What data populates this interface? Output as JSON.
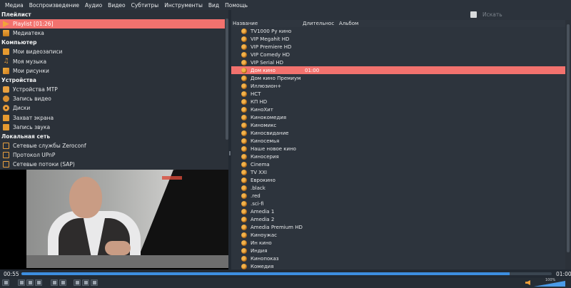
{
  "menu": [
    "Медиа",
    "Воспроизведение",
    "Аудио",
    "Видео",
    "Субтитры",
    "Инструменты",
    "Вид",
    "Помощь"
  ],
  "sidebar": {
    "sections": [
      {
        "title": "Плейлист",
        "items": [
          {
            "label": "Playlist [01:26]",
            "icon": "play-icon",
            "selected": true
          },
          {
            "label": "Медиатека",
            "icon": "library-icon",
            "selected": false
          }
        ]
      },
      {
        "title": "Компьютер",
        "items": [
          {
            "label": "Мои видеозаписи",
            "icon": "video-folder-icon",
            "selected": false
          },
          {
            "label": "Моя музыка",
            "icon": "music-note-icon",
            "selected": false
          },
          {
            "label": "Мои рисунки",
            "icon": "picture-icon",
            "selected": false
          }
        ]
      },
      {
        "title": "Устройства",
        "items": [
          {
            "label": "Устройства MTP",
            "icon": "device-icon",
            "selected": false
          },
          {
            "label": "Запись видео",
            "icon": "camera-icon",
            "selected": false
          },
          {
            "label": "Диски",
            "icon": "disc-icon",
            "selected": false
          },
          {
            "label": "Захват экрана",
            "icon": "screen-capture-icon",
            "selected": false
          },
          {
            "label": "Запись звука",
            "icon": "audio-capture-icon",
            "selected": false
          }
        ]
      },
      {
        "title": "Локальная сеть",
        "items": [
          {
            "label": "Сетевые службы Zeroconf",
            "icon": "network-icon",
            "selected": false
          },
          {
            "label": "Протокол UPnP",
            "icon": "network-icon",
            "selected": false
          },
          {
            "label": "Сетевые потоки (SAP)",
            "icon": "network-icon",
            "selected": false
          }
        ]
      }
    ]
  },
  "search": {
    "placeholder": "Искать"
  },
  "playlist": {
    "columns": {
      "name": "Название",
      "duration": "Длительнос",
      "album": "Альбом"
    },
    "rows": [
      {
        "name": "TV1000 Ру кино",
        "duration": "",
        "selected": false
      },
      {
        "name": "VIP Megahit HD",
        "duration": "",
        "selected": false
      },
      {
        "name": "VIP Premiere HD",
        "duration": "",
        "selected": false
      },
      {
        "name": "VIP Comedy HD",
        "duration": "",
        "selected": false
      },
      {
        "name": "VIP Serial HD",
        "duration": "",
        "selected": false
      },
      {
        "name": "Дом кино",
        "duration": "01:00",
        "selected": true
      },
      {
        "name": "Дом кино Премиум",
        "duration": "",
        "selected": false
      },
      {
        "name": "Иллюзион+",
        "duration": "",
        "selected": false
      },
      {
        "name": "НСТ",
        "duration": "",
        "selected": false
      },
      {
        "name": "КП HD",
        "duration": "",
        "selected": false
      },
      {
        "name": "КиноХит",
        "duration": "",
        "selected": false
      },
      {
        "name": "Кинокомедия",
        "duration": "",
        "selected": false
      },
      {
        "name": "Киномикс",
        "duration": "",
        "selected": false
      },
      {
        "name": "Киносвидание",
        "duration": "",
        "selected": false
      },
      {
        "name": "Киносемья",
        "duration": "",
        "selected": false
      },
      {
        "name": "Наше новое кино",
        "duration": "",
        "selected": false
      },
      {
        "name": "Киносерия",
        "duration": "",
        "selected": false
      },
      {
        "name": "Cinema",
        "duration": "",
        "selected": false
      },
      {
        "name": "TV XXI",
        "duration": "",
        "selected": false
      },
      {
        "name": "Еврокино",
        "duration": "",
        "selected": false
      },
      {
        "name": ".black",
        "duration": "",
        "selected": false
      },
      {
        "name": ".red",
        "duration": "",
        "selected": false
      },
      {
        "name": ".sci-fi",
        "duration": "",
        "selected": false
      },
      {
        "name": "Amedia 1",
        "duration": "",
        "selected": false
      },
      {
        "name": "Amedia 2",
        "duration": "",
        "selected": false
      },
      {
        "name": "Amedia Premium HD",
        "duration": "",
        "selected": false
      },
      {
        "name": "Киноужас",
        "duration": "",
        "selected": false
      },
      {
        "name": "Ин кино",
        "duration": "",
        "selected": false
      },
      {
        "name": "Индия",
        "duration": "",
        "selected": false
      },
      {
        "name": "Кинопоказ",
        "duration": "",
        "selected": false
      },
      {
        "name": "Комедия",
        "duration": "",
        "selected": false
      }
    ]
  },
  "player": {
    "time_elapsed": "00:55",
    "time_total": "01:00",
    "progress": 0.92,
    "volume_percent": 100,
    "volume_label": "100%",
    "accent_color": "#f2726e",
    "seek_color": "#3d8ee0"
  },
  "controls": [
    "pause-icon",
    "previous-icon",
    "stop-icon",
    "next-icon",
    "fullscreen-icon",
    "extended-settings-icon",
    "playlist-icon",
    "loop-icon",
    "shuffle-icon"
  ]
}
